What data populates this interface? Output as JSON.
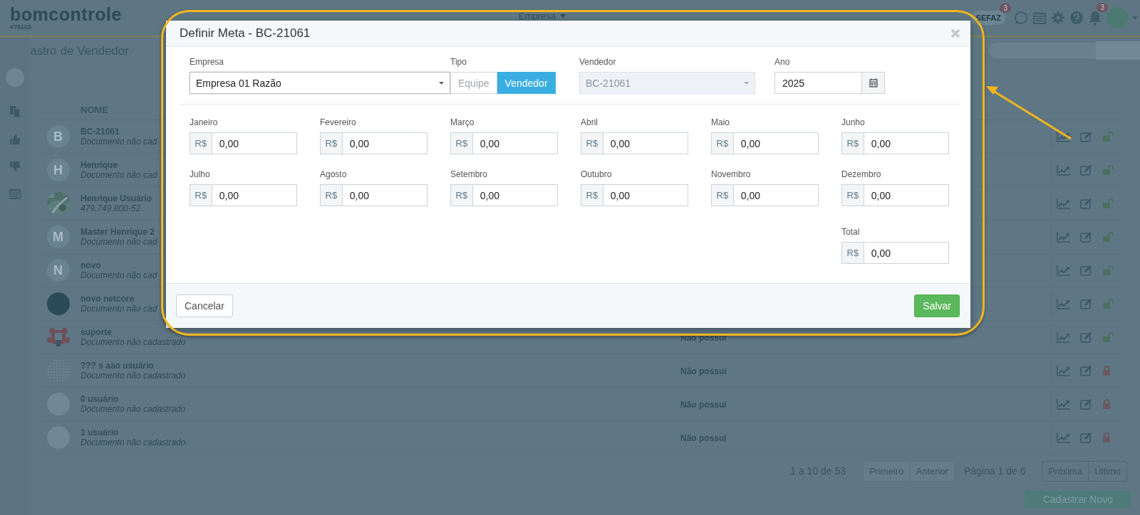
{
  "header": {
    "logo": "bomcontrole",
    "account": "#76165",
    "company_menu": "Empresa",
    "sefaz": "SEFAZ",
    "sefaz_badge": "3",
    "notification_badge": "3"
  },
  "page_title": "astro de Vendedor",
  "table": {
    "columns": [
      "NOME"
    ],
    "rows": [
      {
        "name": "BC-21061",
        "document": "Documento não cad",
        "avatar": {
          "kind": "letter",
          "letter": "B"
        },
        "locked": false
      },
      {
        "name": "Henrique",
        "document": "Documento não cad",
        "avatar": {
          "kind": "letter",
          "letter": "H"
        },
        "locked": false
      },
      {
        "name": "Henrique Usuário",
        "document": "479.749.800-52",
        "locked": false
      },
      {
        "name": "Master Henrique 2",
        "document": "Documento não cad",
        "avatar": {
          "kind": "letter",
          "letter": "M"
        },
        "locked": false
      },
      {
        "name": "novo",
        "document": "Documento não cad",
        "avatar": {
          "kind": "letter",
          "letter": "N"
        },
        "locked": false
      },
      {
        "name": "novo netcore",
        "document": "Documento não cad",
        "avatar": {
          "kind": "solid"
        },
        "locked": false
      },
      {
        "name": "suporte",
        "document": "Documento não cadastrado",
        "plan": "Não possui",
        "avatar": {
          "kind": "mascot"
        },
        "locked": false
      },
      {
        "name": "??? s aao usuário",
        "document": "Documento não cadastrado",
        "plan": "Não possui",
        "avatar": {
          "kind": "pattern"
        },
        "locked": true
      },
      {
        "name": "0 usuário",
        "document": "Documento não cadastrado",
        "plan": "Não possui",
        "avatar": {
          "kind": "blank"
        },
        "locked": true
      },
      {
        "name": "1 usuário",
        "document": "Documento não cadastrado",
        "plan": "Não possui",
        "avatar": {
          "kind": "blank"
        },
        "locked": true
      }
    ]
  },
  "pager": {
    "summary": "1 a 10 de 53",
    "buttons_left": [
      {
        "label": "Primeiro",
        "disabled": true
      },
      {
        "label": "Anterior",
        "disabled": true
      }
    ],
    "page_info": "Página 1 de 6",
    "buttons_right": [
      {
        "label": "Próxima",
        "disabled": false
      },
      {
        "label": "Último",
        "disabled": false
      }
    ]
  },
  "new_button": "Cadastrar Novo",
  "dialog": {
    "title": "Definir Meta - BC-21061",
    "company": {
      "label": "Empresa",
      "value": "Empresa 01 Razão"
    },
    "type": {
      "label": "Tipo",
      "options": [
        {
          "label": "Equipe",
          "selected": false
        },
        {
          "label": "Vendedor",
          "selected": true
        }
      ]
    },
    "seller": {
      "label": "Vendedor",
      "value": "BC-21061",
      "disabled": true
    },
    "year": {
      "label": "Ano",
      "value": "2025"
    },
    "months": [
      {
        "label": "Janeiro",
        "currency": "R$",
        "value": "0,00"
      },
      {
        "label": "Fevereiro",
        "currency": "R$",
        "value": "0,00"
      },
      {
        "label": "Março",
        "currency": "R$",
        "value": "0,00"
      },
      {
        "label": "Abril",
        "currency": "R$",
        "value": "0,00"
      },
      {
        "label": "Maio",
        "currency": "R$",
        "value": "0,00"
      },
      {
        "label": "Junho",
        "currency": "R$",
        "value": "0,00"
      },
      {
        "label": "Julho",
        "currency": "R$",
        "value": "0,00"
      },
      {
        "label": "Agosto",
        "currency": "R$",
        "value": "0,00"
      },
      {
        "label": "Setembro",
        "currency": "R$",
        "value": "0,00"
      },
      {
        "label": "Outubro",
        "currency": "R$",
        "value": "0,00"
      },
      {
        "label": "Novembro",
        "currency": "R$",
        "value": "0,00"
      },
      {
        "label": "Dezembro",
        "currency": "R$",
        "value": "0,00"
      }
    ],
    "total": {
      "label": "Total",
      "currency": "R$",
      "value": "0,00"
    },
    "cancel": "Cancelar",
    "save": "Salvar"
  }
}
